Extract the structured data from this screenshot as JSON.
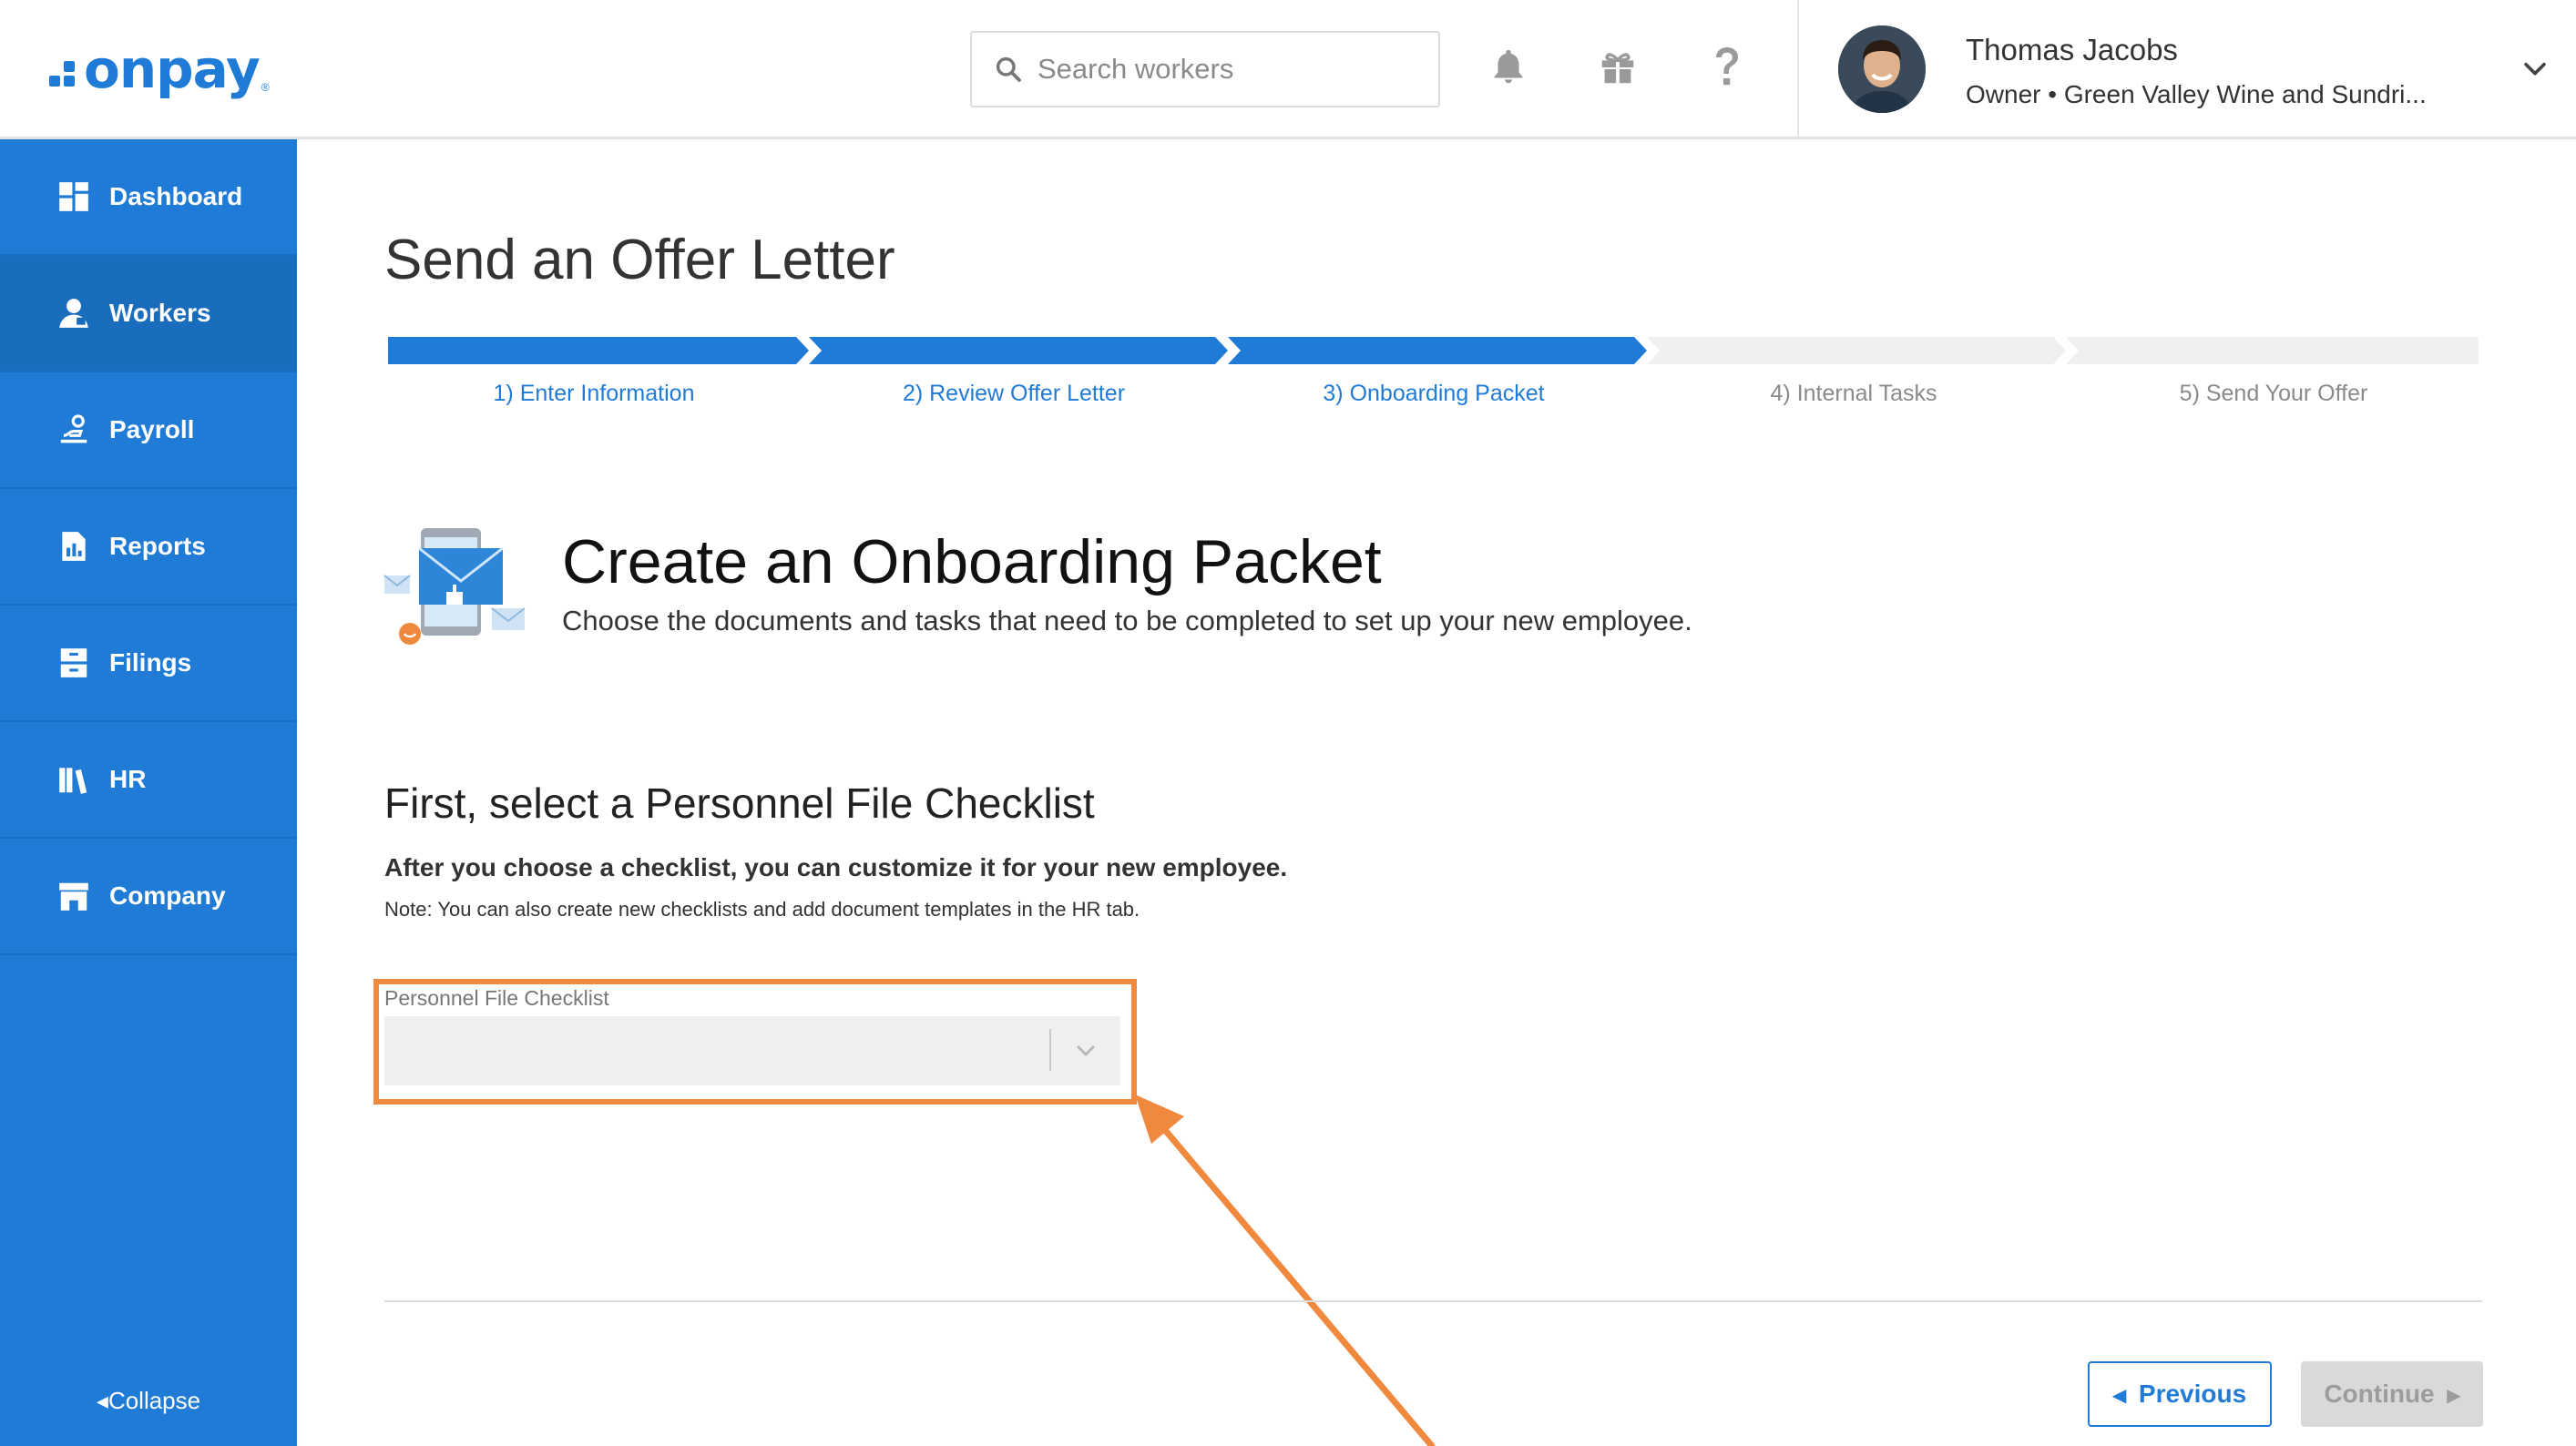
{
  "brand": {
    "name": "onpay",
    "accent": "#1f7bd6"
  },
  "header": {
    "search": {
      "placeholder": "Search workers",
      "value": ""
    },
    "icons": [
      "bell-icon",
      "gift-icon",
      "help-icon"
    ],
    "user": {
      "name": "Thomas Jacobs",
      "role": "Owner • Green Valley Wine and Sundri..."
    }
  },
  "sidebar": {
    "items": [
      {
        "label": "Dashboard",
        "icon": "dashboard-icon",
        "active": false
      },
      {
        "label": "Workers",
        "icon": "workers-icon",
        "active": true
      },
      {
        "label": "Payroll",
        "icon": "payroll-icon",
        "active": false
      },
      {
        "label": "Reports",
        "icon": "reports-icon",
        "active": false
      },
      {
        "label": "Filings",
        "icon": "filings-icon",
        "active": false
      },
      {
        "label": "HR",
        "icon": "hr-icon",
        "active": false
      },
      {
        "label": "Company",
        "icon": "company-icon",
        "active": false
      }
    ],
    "collapse_label": "Collapse"
  },
  "main": {
    "title": "Send an Offer Letter",
    "steps": [
      {
        "label": "1) Enter Information",
        "completed": true
      },
      {
        "label": "2) Review Offer Letter",
        "completed": true
      },
      {
        "label": "3) Onboarding Packet",
        "completed": true
      },
      {
        "label": "4) Internal Tasks",
        "completed": false
      },
      {
        "label": "5) Send Your Offer",
        "completed": false
      }
    ],
    "packet": {
      "title": "Create an Onboarding Packet",
      "subtitle": "Choose the documents and tasks that need to be completed to set up your new employee."
    },
    "section": {
      "title": "First, select a Personnel File Checklist",
      "bold_text": "After you choose a checklist, you can customize it for your new employee.",
      "note": "Note: You can also create new checklists and add document templates in the HR tab."
    },
    "checklist_field": {
      "label": "Personnel File Checklist",
      "value": ""
    },
    "buttons": {
      "previous": "Previous",
      "continue": "Continue"
    }
  },
  "colors": {
    "active_step": "#1f7bd6",
    "inactive_step": "#f0f0f0",
    "annotation": "#f0883e",
    "inactive_text": "#8a8a8a"
  }
}
